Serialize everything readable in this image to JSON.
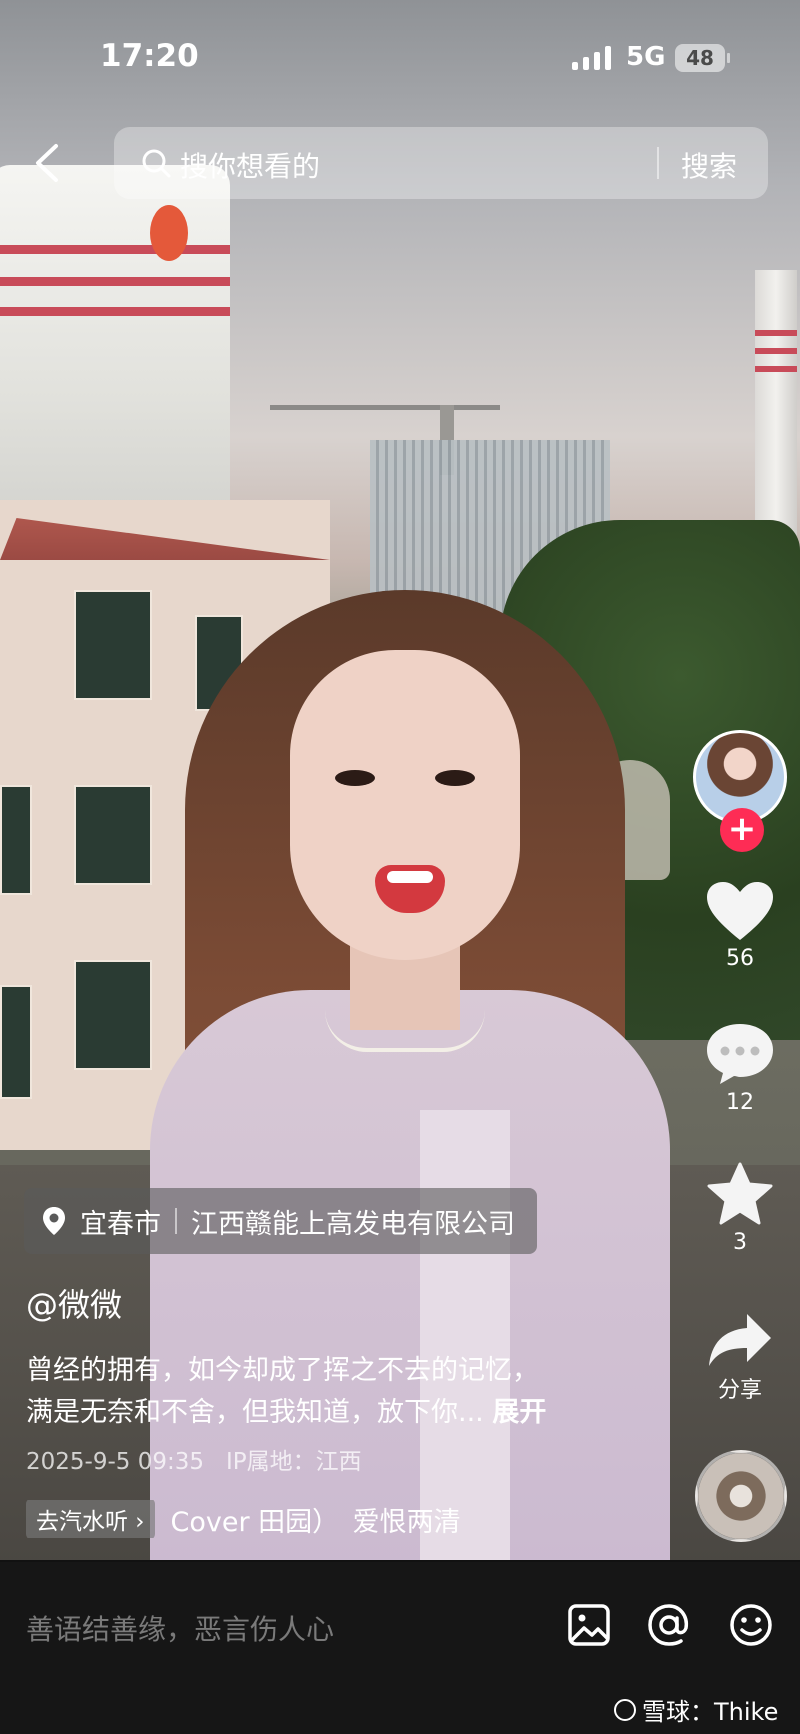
{
  "status_bar": {
    "time": "17:20",
    "network": "5G",
    "battery": "48"
  },
  "search": {
    "placeholder": "搜你想看的",
    "button": "搜索"
  },
  "location": {
    "city": "宜春市",
    "place": "江西赣能上高发电有限公司"
  },
  "author": "@微微",
  "description": {
    "line1": "曾经的拥有，如今却成了挥之不去的记忆，",
    "line2": "满是无奈和不舍，但我知道，放下你...",
    "expand": "展开"
  },
  "meta": {
    "date": "2025-9-5 09:35",
    "ip": "IP属地：江西"
  },
  "music": {
    "tag": "去汽水听 ›",
    "title": "Cover 田园）　爱恨两清"
  },
  "actions": {
    "likes": "56",
    "comments": "12",
    "favorites": "3",
    "share": "分享"
  },
  "comment_input": {
    "placeholder": "善语结善缘，恶言伤人心"
  },
  "watermark": "雪球：Thike",
  "colors": {
    "follow_accent": "#fe2c55",
    "bottom_bar": "#161616"
  }
}
